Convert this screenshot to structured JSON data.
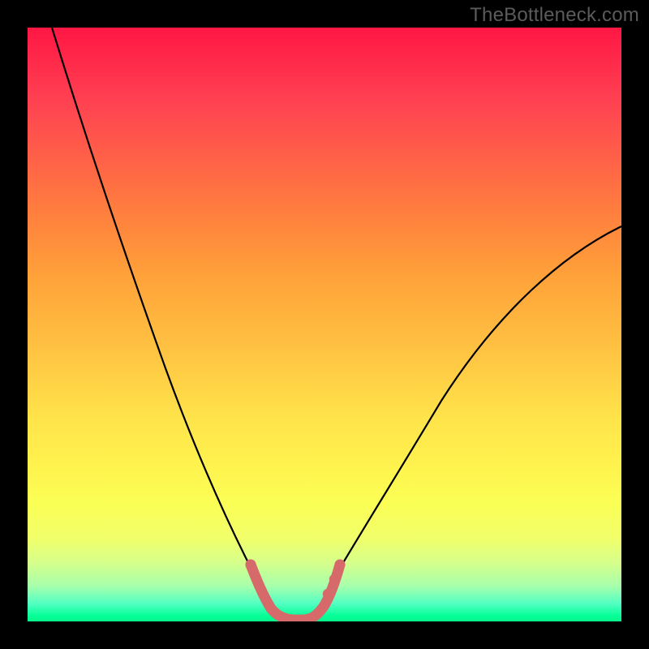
{
  "watermark": "TheBottleneck.com",
  "colors": {
    "background": "#000000",
    "gradient_top": "#ff1744",
    "gradient_mid_orange": "#ff9a3a",
    "gradient_yellow": "#ffe44a",
    "gradient_green": "#07ff98",
    "curve_stroke": "#000000",
    "bottom_curve_stroke": "#d66a6a"
  },
  "chart_data": {
    "type": "line",
    "title": "",
    "xlabel": "",
    "ylabel": "",
    "xlim": [
      0,
      100
    ],
    "ylim": [
      0,
      100
    ],
    "series": [
      {
        "name": "left-curve",
        "x": [
          4,
          8,
          12,
          16,
          20,
          24,
          28,
          32,
          34,
          36,
          38,
          40
        ],
        "y": [
          100,
          84,
          70,
          57,
          45,
          35,
          26,
          18,
          14,
          11,
          8,
          5
        ]
      },
      {
        "name": "right-curve",
        "x": [
          50,
          54,
          58,
          64,
          70,
          76,
          82,
          88,
          94,
          100
        ],
        "y": [
          5,
          9,
          14,
          22,
          30,
          38,
          46,
          53,
          60,
          66
        ]
      },
      {
        "name": "bottom-pink-curve",
        "x": [
          38,
          40,
          42,
          44,
          46,
          48,
          50,
          52
        ],
        "y": [
          10,
          4,
          1,
          0,
          0,
          1,
          4,
          10
        ]
      }
    ],
    "annotations": []
  }
}
